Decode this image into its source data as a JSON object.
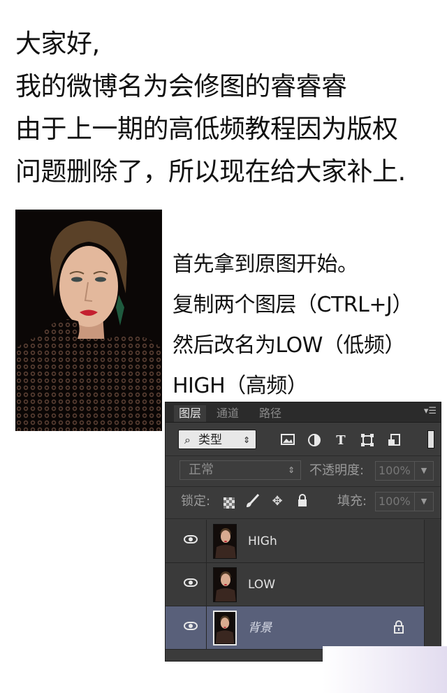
{
  "intro": {
    "lines": [
      "大家好,",
      "我的微博名为会修图的睿睿睿",
      "由于上一期的高低频教程因为版权",
      "问题删除了，所以现在给大家补上."
    ]
  },
  "steps": {
    "lines": [
      "首先拿到原图开始。",
      "复制两个图层（CTRL+J）",
      "然后改名为LOW（低频）",
      "HIGH（高频）"
    ]
  },
  "panel": {
    "tabs": [
      "图层",
      "通道",
      "路径"
    ],
    "active_tab": "图层",
    "menu_icon": "panel-menu-icon",
    "filter": {
      "kind_label": "类型",
      "icons": [
        "image-filter-icon",
        "adjustment-filter-icon",
        "type-filter-icon",
        "shape-filter-icon",
        "smart-object-filter-icon"
      ]
    },
    "blend_mode": "正常",
    "opacity_label": "不透明度:",
    "opacity_value": "100%",
    "lock_label": "锁定:",
    "fill_label": "填充:",
    "fill_value": "100%",
    "layers": [
      {
        "name": "HIGh",
        "visible": true,
        "selected": false,
        "locked": false
      },
      {
        "name": "LOW",
        "visible": true,
        "selected": false,
        "locked": false
      },
      {
        "name": "背景",
        "visible": true,
        "selected": true,
        "locked": true
      }
    ]
  },
  "colors": {
    "panel_bg": "#3b3b3b",
    "selected_layer": "#59607a",
    "text_main": "#111111"
  }
}
